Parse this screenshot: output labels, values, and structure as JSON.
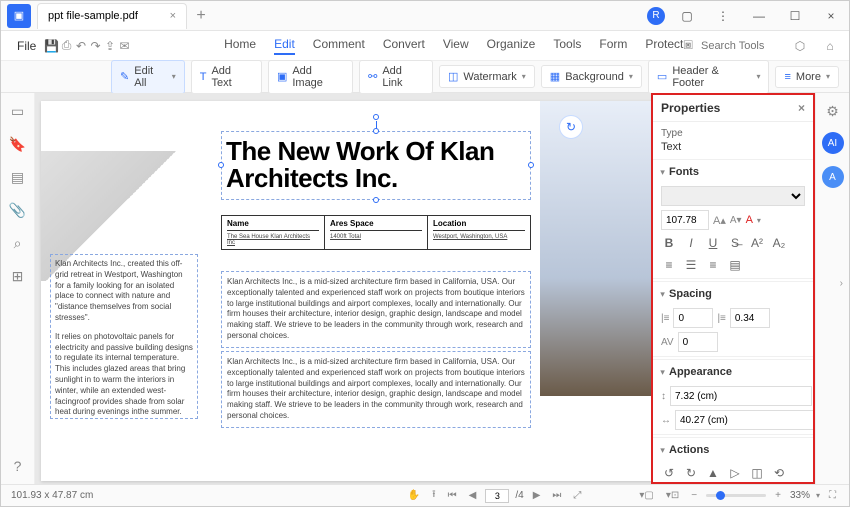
{
  "window": {
    "tab_title": "ppt file-sample.pdf"
  },
  "menu": {
    "file": "File",
    "tabs": [
      "Home",
      "Edit",
      "Comment",
      "Convert",
      "View",
      "Organize",
      "Tools",
      "Form",
      "Protect"
    ],
    "active_tab": "Edit",
    "search_placeholder": "Search Tools"
  },
  "ribbon": {
    "edit_all": "Edit All",
    "add_text": "Add Text",
    "add_image": "Add Image",
    "add_link": "Add Link",
    "watermark": "Watermark",
    "background": "Background",
    "header_footer": "Header & Footer",
    "more": "More"
  },
  "document": {
    "headline": "The New Work Of Klan Architects Inc.",
    "table": {
      "c1_h": "Name",
      "c1_v": "The Sea House Klan Architects Inc",
      "c2_h": "Ares Space",
      "c2_v": "1400ft Total",
      "c3_h": "Location",
      "c3_v": "Westport, Washington, USA"
    },
    "sidebar_p1": "Klan Architects Inc., created this off-grid retreat in Westport, Washington for a family looking for an isolated place to connect with nature and \"distance themselves from social stresses\".",
    "sidebar_p2": "It relies on photovoltaic panels for electricity and passive building designs to regulate its internal temperature. This includes glazed areas that bring sunlight in to warm the interiors in winter, while an extended west-facingroof provides shade from solar heat during evenings inthe summer.",
    "body": "Klan Architects Inc., is a mid-sized architecture firm based in California, USA. Our exceptionally talented and experienced staff work on projects from boutique interiors to large institutional buildings and airport complexes, locally and internationally. Our firm houses their architecture, interior design, graphic design, landscape and model making staff. We strieve to be leaders in the community through work, research and personal choices."
  },
  "properties": {
    "title": "Properties",
    "type_label": "Type",
    "type_value": "Text",
    "fonts_label": "Fonts",
    "font_size": "107.78",
    "spacing_label": "Spacing",
    "line_spacing": "0",
    "char_spacing": "0.34",
    "baseline": "0",
    "appearance_label": "Appearance",
    "width": "7.32 (cm)",
    "height": "40.27 (cm)",
    "actions_label": "Actions"
  },
  "statusbar": {
    "coords": "101.93 x 47.87 cm",
    "page_current": "3",
    "page_total": "4",
    "zoom": "33%"
  }
}
